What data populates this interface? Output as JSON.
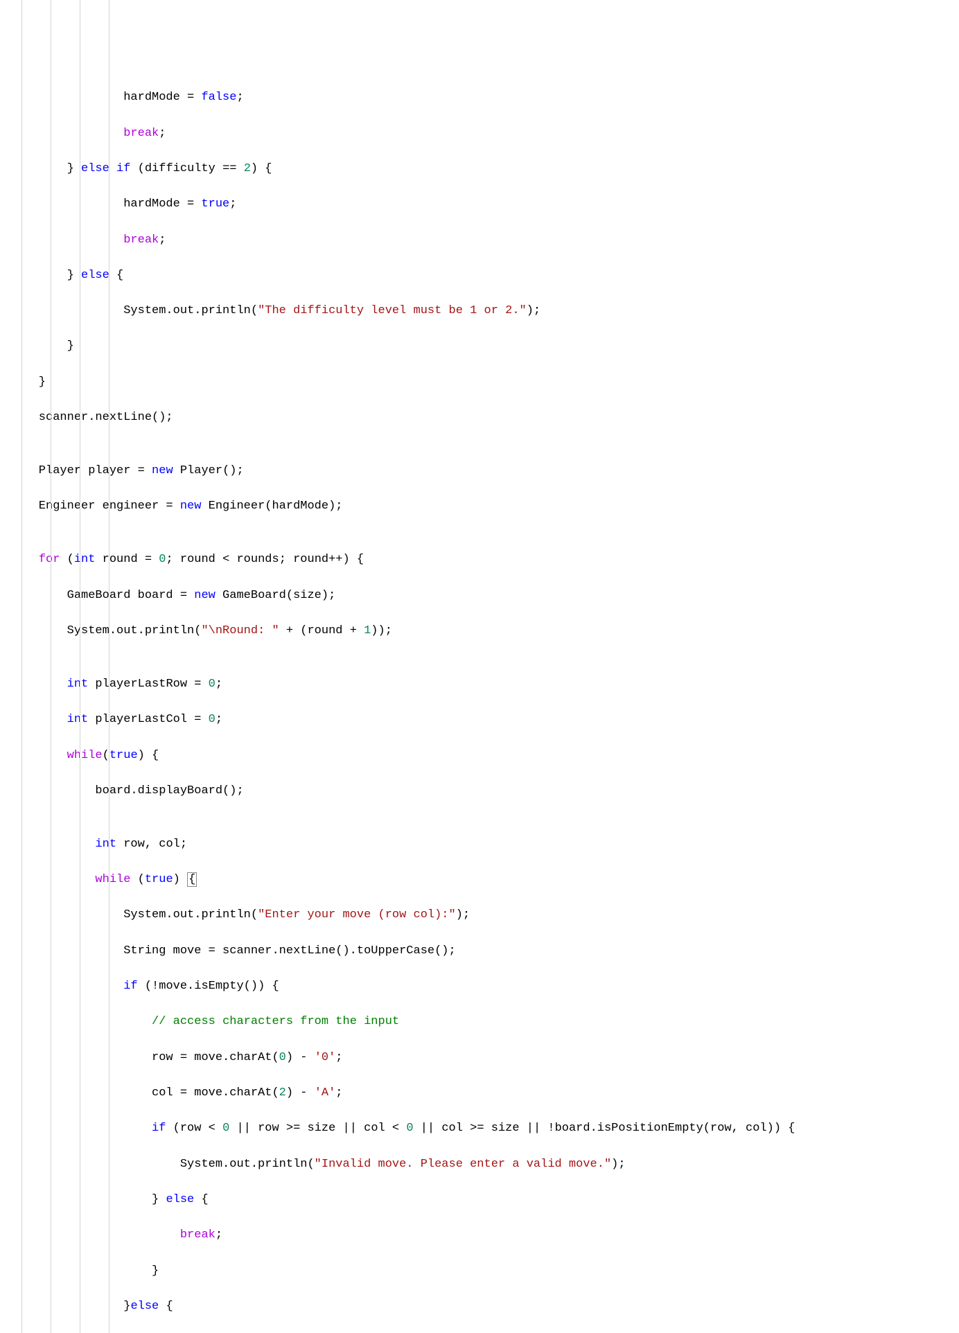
{
  "code": {
    "l1": "                hardMode = ",
    "l1_val": "false",
    "l1_end": ";",
    "l2": "                ",
    "l2_kw": "break",
    "l2_end": ";",
    "l3": "        } ",
    "l3_kw1": "else",
    "l3_mid": " ",
    "l3_kw2": "if",
    "l3_mid2": " (difficulty == ",
    "l3_num": "2",
    "l3_end": ") {",
    "l4": "                hardMode = ",
    "l4_val": "true",
    "l4_end": ";",
    "l5": "                ",
    "l5_kw": "break",
    "l5_end": ";",
    "l6": "        } ",
    "l6_kw": "else",
    "l6_end": " {",
    "l7": "                System.out.println(",
    "l7_str": "\"The difficulty level must be 1 or 2.\"",
    "l7_end": ");",
    "l8": "        }",
    "l9": "    }",
    "l10": "    scanner.nextLine();",
    "l11": "",
    "l12": "    Player player = ",
    "l12_kw": "new",
    "l12_end": " Player();",
    "l13": "    Engineer engineer = ",
    "l13_kw": "new",
    "l13_end": " Engineer(hardMode);",
    "l14": "",
    "l15": "    ",
    "l15_kw1": "for",
    "l15_mid1": " (",
    "l15_kw2": "int",
    "l15_mid2": " round = ",
    "l15_num": "0",
    "l15_end": "; round < rounds; round++) {",
    "l16": "        GameBoard board = ",
    "l16_kw": "new",
    "l16_end": " GameBoard(size);",
    "l17": "        System.out.println(",
    "l17_str1": "\"\\nRound: \"",
    "l17_mid": " + (round + ",
    "l17_num": "1",
    "l17_end": "));",
    "l18": "",
    "l19": "        ",
    "l19_kw": "int",
    "l19_mid": " playerLastRow = ",
    "l19_num": "0",
    "l19_end": ";",
    "l20": "        ",
    "l20_kw": "int",
    "l20_mid": " playerLastCol = ",
    "l20_num": "0",
    "l20_end": ";",
    "l21": "        ",
    "l21_kw": "while",
    "l21_mid": "(",
    "l21_val": "true",
    "l21_end": ") {",
    "l22": "            board.displayBoard();",
    "l23": "",
    "l24": "            ",
    "l24_kw": "int",
    "l24_end": " row, col;",
    "l25": "            ",
    "l25_kw": "while",
    "l25_mid": " (",
    "l25_val": "true",
    "l25_paren": ") ",
    "l25_brace": "{",
    "l26": "                System.out.println(",
    "l26_str": "\"Enter your move (row col):\"",
    "l26_end": ");",
    "l27": "                String move = scanner.nextLine().toUpperCase();",
    "l28": "                ",
    "l28_kw": "if",
    "l28_end": " (!move.isEmpty()) {",
    "l29": "                    ",
    "l29_comment": "// access characters from the input",
    "l30": "                    row = move.charAt(",
    "l30_num": "0",
    "l30_mid": ") - ",
    "l30_str": "'0'",
    "l30_end": ";",
    "l31": "                    col = move.charAt(",
    "l31_num": "2",
    "l31_mid": ") - ",
    "l31_str": "'A'",
    "l31_end": ";",
    "l32": "                    ",
    "l32_kw": "if",
    "l32_mid1": " (row < ",
    "l32_num1": "0",
    "l32_mid2": " || row >= size || col < ",
    "l32_num2": "0",
    "l32_end": " || col >= size || !board.isPositionEmpty(row, col)) {",
    "l33": "                        System.out.println(",
    "l33_str": "\"Invalid move. Please enter a valid move.\"",
    "l33_end": ");",
    "l34": "                    } ",
    "l34_kw": "else",
    "l34_end": " {",
    "l35": "                        ",
    "l35_kw": "break",
    "l35_end": ";",
    "l36": "                    }",
    "l37": "                }",
    "l37_kw": "else",
    "l37_end": " {"
  }
}
